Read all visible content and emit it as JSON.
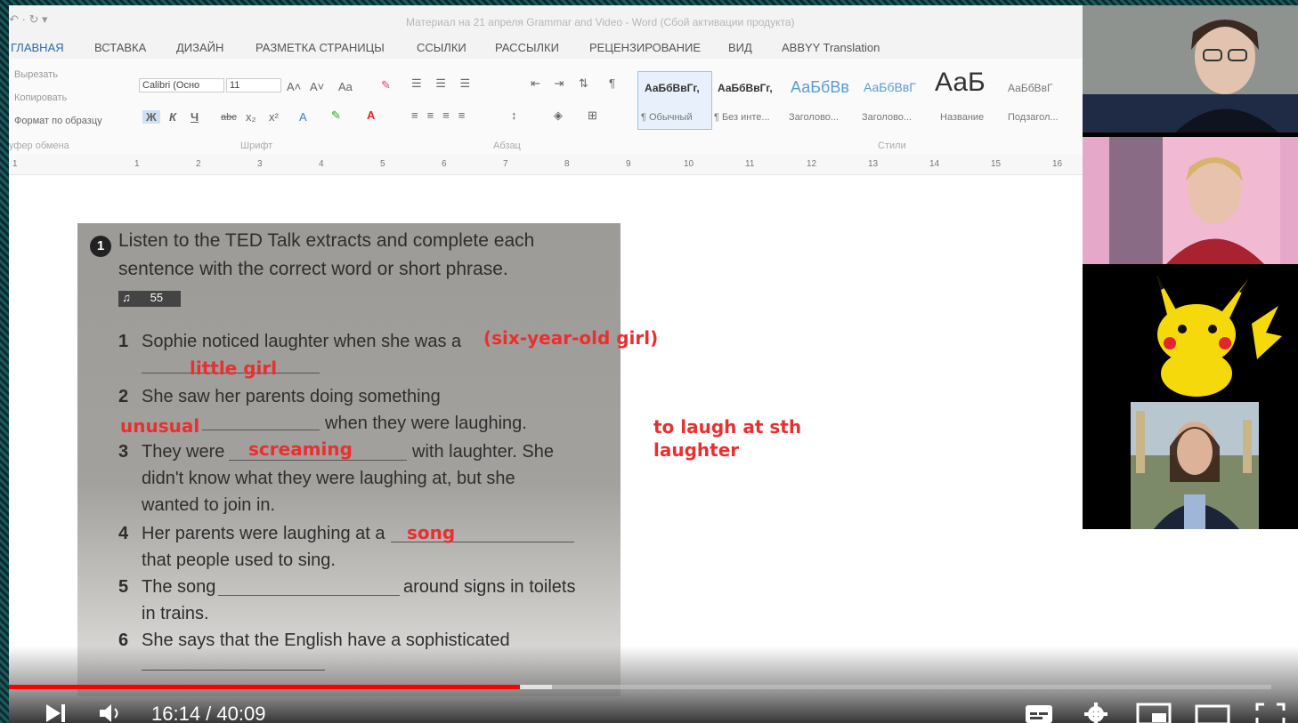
{
  "word": {
    "quick_access": "↶ · ↻ ▾",
    "title": "Материал на 21 апреля Grammar and Video - Word (Сбой активации продукта)",
    "tabs": [
      "ГЛАВНАЯ",
      "ВСТАВКА",
      "ДИЗАЙН",
      "РАЗМЕТКА СТРАНИЦЫ",
      "ССЫЛКИ",
      "РАССЫЛКИ",
      "РЕЦЕНЗИРОВАНИЕ",
      "ВИД",
      "ABBYY Translation"
    ],
    "clipboard": {
      "cut": "Вырезать",
      "copy": "Копировать",
      "format_painter": "Формат по образцу",
      "group": "уфер обмена"
    },
    "font": {
      "name": "Calibri (Осно",
      "size": "11",
      "bold": "Ж",
      "italic": "К",
      "underline": "Ч",
      "strike": "abc",
      "sub": "x₂",
      "sup": "x²",
      "grow": "A˄",
      "shrink": "A˅",
      "case": "Aa",
      "group": "Шрифт"
    },
    "paragraph": {
      "group": "Абзац"
    },
    "styles": {
      "group": "Стили",
      "items": [
        {
          "sample": "АаБбВвГг,",
          "name": "¶ Обычный"
        },
        {
          "sample": "АаБбВвГг,",
          "name": "¶ Без инте..."
        },
        {
          "sample": "АаБбВв",
          "name": "Заголово..."
        },
        {
          "sample": "АаБбВвГ",
          "name": "Заголово..."
        },
        {
          "sample": "АаБ",
          "name": "Название"
        },
        {
          "sample": "АаБбВвГ",
          "name": "Подзагол..."
        }
      ]
    },
    "ruler_ticks": [
      "1",
      "1",
      "2",
      "3",
      "4",
      "5",
      "6",
      "7",
      "8",
      "9",
      "10",
      "11",
      "12",
      "13",
      "14",
      "15",
      "16"
    ]
  },
  "exercise": {
    "number": "1",
    "instruction_1": "Listen to the TED Talk extracts and complete each",
    "instruction_2": "sentence with the correct word or short phrase.",
    "audio_track": "55",
    "items": [
      {
        "num": "1",
        "line1": "Sophie noticed laughter when she was a",
        "line2": ""
      },
      {
        "num": "2",
        "line1": "She saw her parents doing something",
        "line2": "when they were laughing."
      },
      {
        "num": "3",
        "line1": "They were",
        "line1b": "with laughter. She",
        "line2": "didn't know what they were laughing at, but she",
        "line3": "wanted to join in."
      },
      {
        "num": "4",
        "line1": "Her parents were laughing at a",
        "line2": "that people used to sing."
      },
      {
        "num": "5",
        "line1": "The song",
        "line1b": "around signs in toilets",
        "line2": "in trains."
      },
      {
        "num": "6",
        "line1": "She says that the English have a sophisticated",
        "line2": ""
      }
    ],
    "annotations": {
      "a1_hint": "(six-year-old girl)",
      "a1": "little girl",
      "a2": "unusual",
      "a3": "screaming",
      "a4": "song"
    }
  },
  "note": {
    "line1": "to laugh at sth",
    "line2": "laughter"
  },
  "player": {
    "current_time": "16:14",
    "separator": " / ",
    "duration": "40:09",
    "progress": 0.405,
    "buffered": 0.43
  },
  "colors": {
    "annotation_red": "#e83030",
    "progress_red": "#ff0000",
    "word_blue": "#2b6bb2"
  }
}
